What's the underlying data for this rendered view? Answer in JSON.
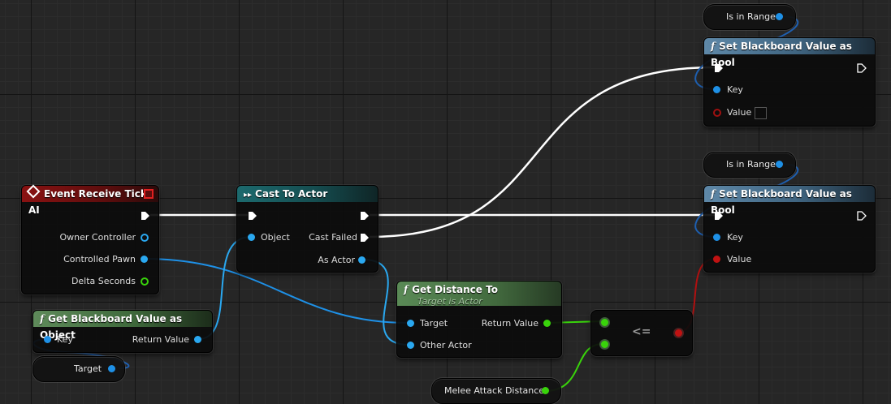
{
  "nodes": {
    "event_tick": {
      "title": "Event Receive Tick AI",
      "pins": {
        "owner_controller": "Owner Controller",
        "controlled_pawn": "Controlled Pawn",
        "delta_seconds": "Delta Seconds"
      }
    },
    "cast": {
      "title": "Cast To Actor",
      "pins": {
        "object": "Object",
        "cast_failed": "Cast Failed",
        "as_actor": "As Actor"
      }
    },
    "get_bb_object": {
      "title": "Get Blackboard Value as Object",
      "pins": {
        "key": "Key",
        "return_value": "Return Value"
      }
    },
    "get_distance": {
      "title": "Get Distance To",
      "subtitle": "Target is Actor",
      "pins": {
        "target": "Target",
        "other_actor": "Other Actor",
        "return_value": "Return Value"
      }
    },
    "compare": {
      "operator": "<="
    },
    "set_bb_bool_1": {
      "title": "Set Blackboard Value as Bool",
      "pins": {
        "key": "Key",
        "value": "Value"
      }
    },
    "set_bb_bool_2": {
      "title": "Set Blackboard Value as Bool",
      "pins": {
        "key": "Key",
        "value": "Value"
      }
    }
  },
  "variables": {
    "is_in_range_1": "Is in Range",
    "is_in_range_2": "Is in Range",
    "target": "Target",
    "melee_attack_distance": "Melee Attack Distance"
  },
  "icons": {
    "function": "f",
    "event": "event-diamond-icon",
    "cast": "cast-arrow-icon"
  },
  "colors": {
    "object_pin": "#1e90e6",
    "float_pin": "#39d30b",
    "bool_pin": "#c01212",
    "exec_wire": "#ffffff",
    "event_header": "#8a1212",
    "cast_header": "#1c6a6e",
    "function_header": "#5e88a8",
    "pure_header": "#5e8a5a"
  }
}
